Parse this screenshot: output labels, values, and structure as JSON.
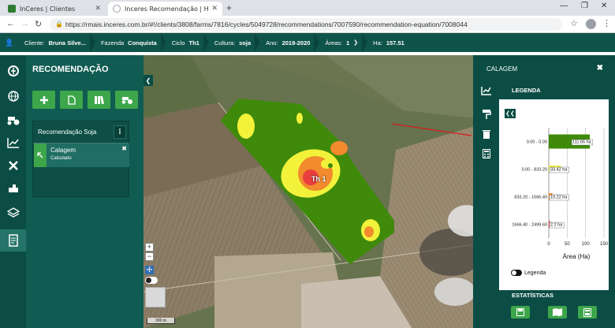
{
  "browser": {
    "tabs": [
      {
        "title": "InCeres | Clientes",
        "fav_color": "#2e7d32"
      },
      {
        "title": "Inceres Recomendação | Home",
        "fav_color": "#9aa0a6"
      }
    ],
    "url": "https://rmais.inceres.com.br/#!/clients/3808/farms/7816/cycles/5049728/recommendations/7007590/recommendation-equation/7008044"
  },
  "header": {
    "cliente_label": "Cliente:",
    "cliente_value": "Bruna Silve...",
    "fazenda_label": "Fazenda",
    "fazenda_value": "Conquista",
    "ciclo_label": "Ciclo",
    "ciclo_value": "Th1",
    "cultura_label": "Cultura:",
    "cultura_value": "soja",
    "ano_label": "Ano:",
    "ano_value": "2019-2020",
    "areas_label": "Áreas:",
    "areas_value": "1",
    "ha_label": "Ha:",
    "ha_value": "157.51"
  },
  "left_panel": {
    "title": "RECOMENDAÇÃO",
    "recommendation_name": "Recomendação Soja",
    "menu_glyph": "⁝",
    "item_name": "Calagem",
    "item_status": "Calculado"
  },
  "map": {
    "field_label": "Th 1",
    "scale_label": "300 m"
  },
  "right_panel": {
    "title": "CALAGEM",
    "legend_title": "LEGENDA",
    "legend_toggle_label": "Legenda",
    "stats_title": "ESTATÍSTICAS"
  },
  "chart_data": {
    "type": "bar",
    "orientation": "horizontal",
    "categories": [
      "0.00 - 0.00",
      "0.00 - 833.20",
      "833.20 - 1666.40",
      "1666.40 - 2499.60"
    ],
    "values": [
      111.65,
      33.42,
      10.22,
      2.2
    ],
    "data_labels": [
      "111.65 ha",
      "33.42 ha",
      "10.22 ha",
      "2.2 ha"
    ],
    "colors": [
      "#3f8a0a",
      "#f2f23a",
      "#f28a2e",
      "#e83e3e"
    ],
    "xlabel": "Área (Ha)",
    "xticks": [
      "0",
      "50",
      "100",
      "150"
    ],
    "xlim": [
      0,
      150
    ],
    "grid": true
  }
}
